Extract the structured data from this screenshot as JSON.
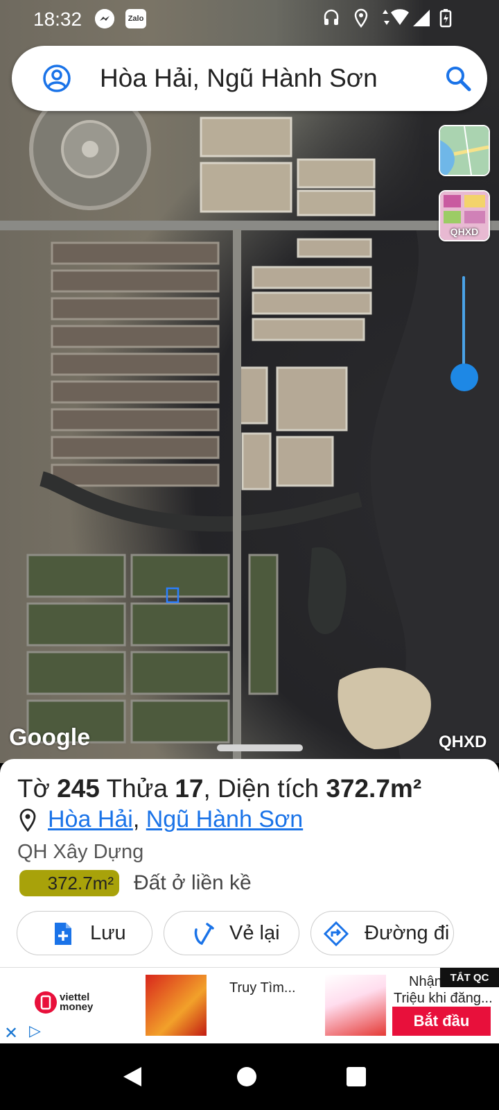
{
  "status_bar": {
    "time": "18:32",
    "app_icons": [
      "messenger-icon",
      "zalo-icon"
    ],
    "zalo_label": "Zalo",
    "system_icons": [
      "headphones-icon",
      "location-icon",
      "wifi-icon",
      "signal-icon",
      "battery-charging-icon"
    ]
  },
  "search": {
    "query": "Hòa Hải, Ngũ Hành Sơn"
  },
  "map": {
    "layer_qhxd_label": "QHXD",
    "google_logo": "Google",
    "watermark": "QHXD"
  },
  "parcel": {
    "to_prefix": "Tờ ",
    "to_number": "245",
    "thua_prefix": " Thửa ",
    "thua_number": "17",
    "area_prefix": ", Diện tích ",
    "area_value": "372.7m²",
    "ward": "Hòa Hải",
    "separator": ", ",
    "district": "Ngũ Hành Sơn",
    "plan_type": "QH Xây Dựng",
    "zone_area": "372.7m²",
    "zone_color": "#a8a20a",
    "land_use": "Đất ở liền kề"
  },
  "actions": {
    "save": "Lưu",
    "redraw": "Vẻ lại",
    "directions": "Đường đi"
  },
  "ad": {
    "brand": "viettel money",
    "title1": "Truy Tìm...",
    "title2_line1": "Nhận",
    "title2_line2": "Triệu khi đăng...",
    "hide_label": "TẮT QC",
    "cta": "Bắt đầu"
  },
  "accent_color": "#1a73e8"
}
